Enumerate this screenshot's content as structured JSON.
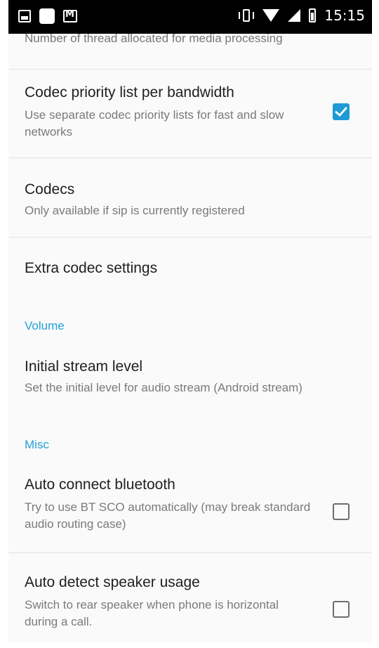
{
  "status_bar": {
    "time": "15:15",
    "left_icons": [
      "image-icon",
      "square-icon",
      "mail-icon"
    ],
    "right_icons": [
      "vibrate-icon",
      "wifi-icon",
      "signal-icon",
      "battery-icon"
    ]
  },
  "partial_row": {
    "summary": "Number of thread allocated for media processing"
  },
  "settings": {
    "codec_priority": {
      "title": "Codec priority list per bandwidth",
      "summary": "Use separate codec priority lists for fast and slow networks",
      "checked": true
    },
    "codecs": {
      "title": "Codecs",
      "summary": "Only available if sip is currently registered"
    },
    "extra_codec": {
      "title": "Extra codec settings"
    },
    "volume_header": "Volume",
    "initial_stream": {
      "title": "Initial stream level",
      "summary": "Set the initial level for audio stream (Android stream)"
    },
    "misc_header": "Misc",
    "auto_bluetooth": {
      "title": "Auto connect bluetooth",
      "summary": "Try to use BT SCO automatically (may break standard audio routing case)",
      "checked": false
    },
    "auto_speaker": {
      "title": "Auto detect speaker usage",
      "summary": "Switch to rear speaker when phone is horizontal during a call.",
      "checked": false
    }
  },
  "colors": {
    "accent": "#1e9ad6",
    "section_header": "#22a1d8",
    "status_bar": "#000000",
    "background": "#fafafa"
  }
}
